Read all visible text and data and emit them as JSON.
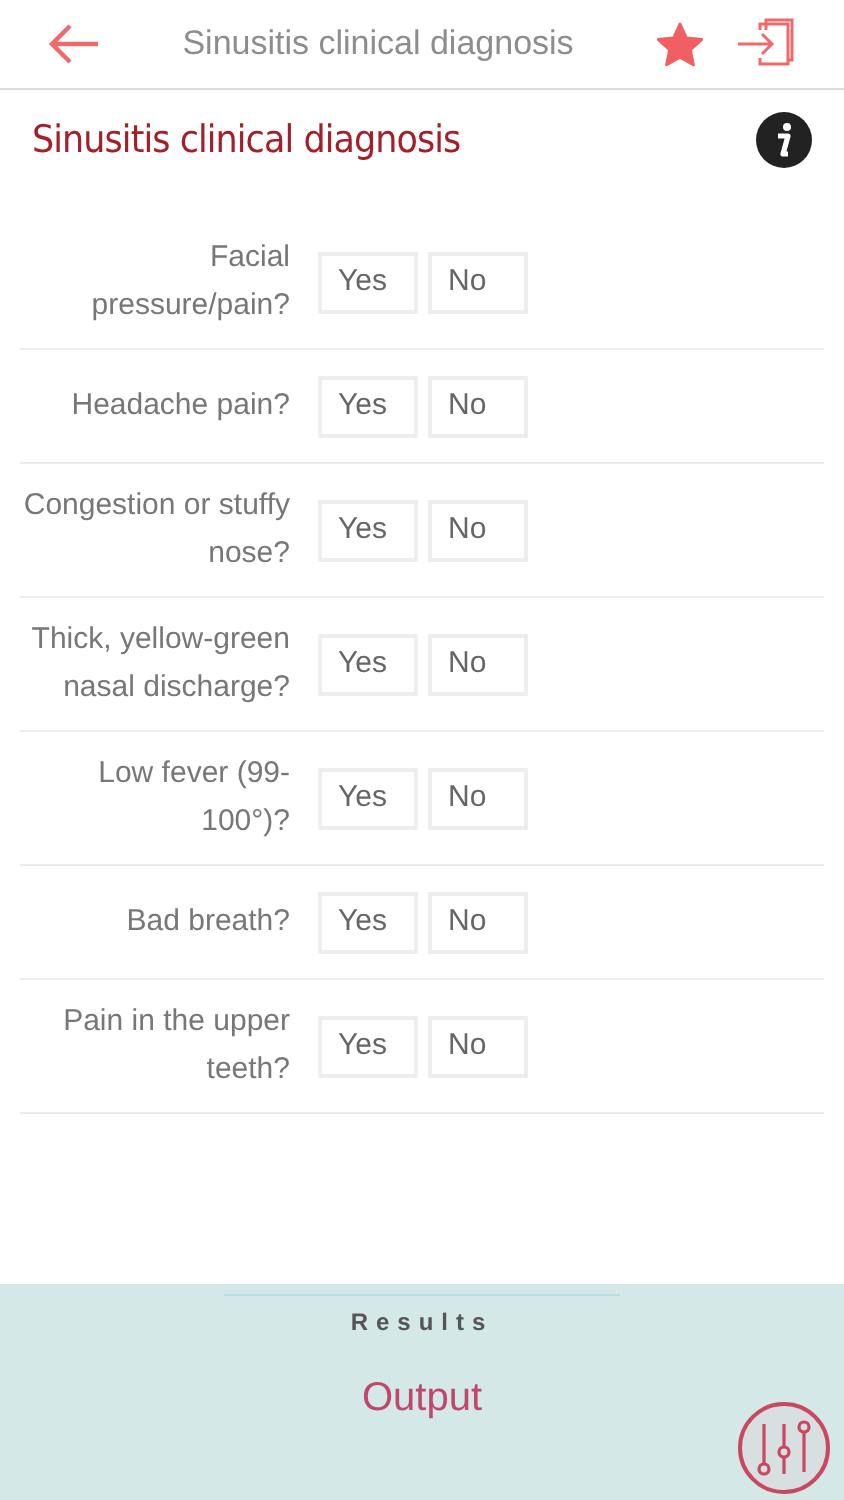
{
  "header": {
    "title": "Sinusitis clinical diagnosis",
    "favorite": true
  },
  "calculator": {
    "title": "Sinusitis clinical diagnosis"
  },
  "questions": [
    {
      "label": "Facial pressure/pain?",
      "answers": [
        {
          "label": "Yes",
          "selected": false
        },
        {
          "label": "No",
          "selected": false
        }
      ]
    },
    {
      "label": "Headache pain?",
      "answers": [
        {
          "label": "Yes",
          "selected": false
        },
        {
          "label": "No",
          "selected": false
        }
      ]
    },
    {
      "label": "Congestion or stuffy nose?",
      "answers": [
        {
          "label": "Yes",
          "selected": false
        },
        {
          "label": "No",
          "selected": false
        }
      ]
    },
    {
      "label": "Thick, yellow-green nasal discharge?",
      "answers": [
        {
          "label": "Yes",
          "selected": false
        },
        {
          "label": "No",
          "selected": false
        }
      ]
    },
    {
      "label": "Low fever (99-100°)?",
      "answers": [
        {
          "label": "Yes",
          "selected": false
        },
        {
          "label": "No",
          "selected": false
        }
      ]
    },
    {
      "label": "Bad breath?",
      "answers": [
        {
          "label": "Yes",
          "selected": false
        },
        {
          "label": "No",
          "selected": false
        }
      ]
    },
    {
      "label": "Pain in the upper teeth?",
      "answers": [
        {
          "label": "Yes",
          "selected": false
        },
        {
          "label": "No",
          "selected": false
        }
      ]
    }
  ],
  "results": {
    "heading": "Results",
    "output": "Output"
  }
}
